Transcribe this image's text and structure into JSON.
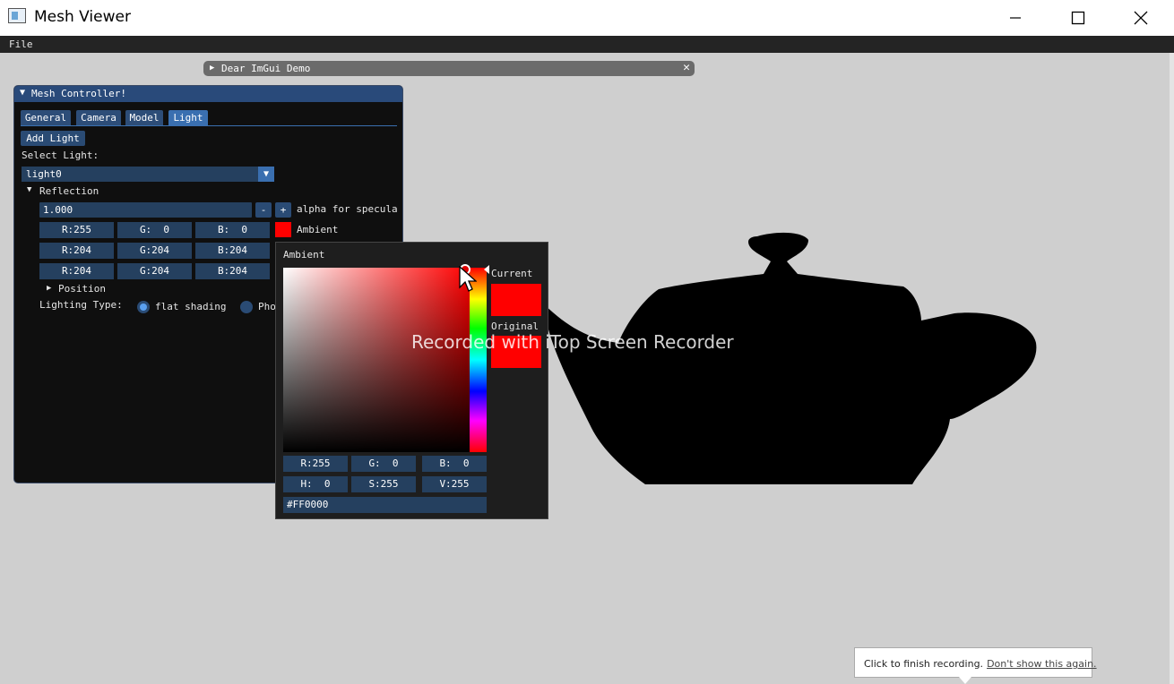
{
  "window": {
    "title": "Mesh Viewer"
  },
  "menu": {
    "file": "File"
  },
  "demo_window": {
    "title": "Dear ImGui Demo",
    "close_glyph": "✕",
    "collapse_glyph": "▶"
  },
  "mesh_controller": {
    "title": "Mesh Controller!",
    "collapse_glyph": "▼",
    "tabs": [
      "General",
      "Camera",
      "Model",
      "Light"
    ],
    "active_tab": "Light",
    "add_light": "Add Light",
    "select_light_label": "Select Light:",
    "selected_light": "light0",
    "reflection_header": "Reflection",
    "alpha": {
      "value": "1.000",
      "minus": "-",
      "plus": "+",
      "label": "alpha for specula"
    },
    "rgb_rows": [
      {
        "r": "R:255",
        "g": "G:  0",
        "b": "B:  0",
        "label": "Ambient"
      },
      {
        "r": "R:204",
        "g": "G:204",
        "b": "B:204"
      },
      {
        "r": "R:204",
        "g": "G:204",
        "b": "B:204"
      }
    ],
    "position_header": "Position",
    "lighting_type_label": "Lighting Type:",
    "lighting_options": [
      "flat shading",
      "Pho"
    ],
    "selected_lighting": "flat shading"
  },
  "color_picker": {
    "title": "Ambient",
    "current_label": "Current",
    "original_label": "Original",
    "rgb": {
      "r": "R:255",
      "g": "G:  0",
      "b": "B:  0"
    },
    "hsv": {
      "h": "H:  0",
      "s": "S:255",
      "v": "V:255"
    },
    "hex": "#FF0000",
    "color": "#ff0000"
  },
  "watermark": "Recorded with iTop Screen Recorder",
  "toast": {
    "message": "Click to finish recording.",
    "link": "Don't show this again."
  }
}
